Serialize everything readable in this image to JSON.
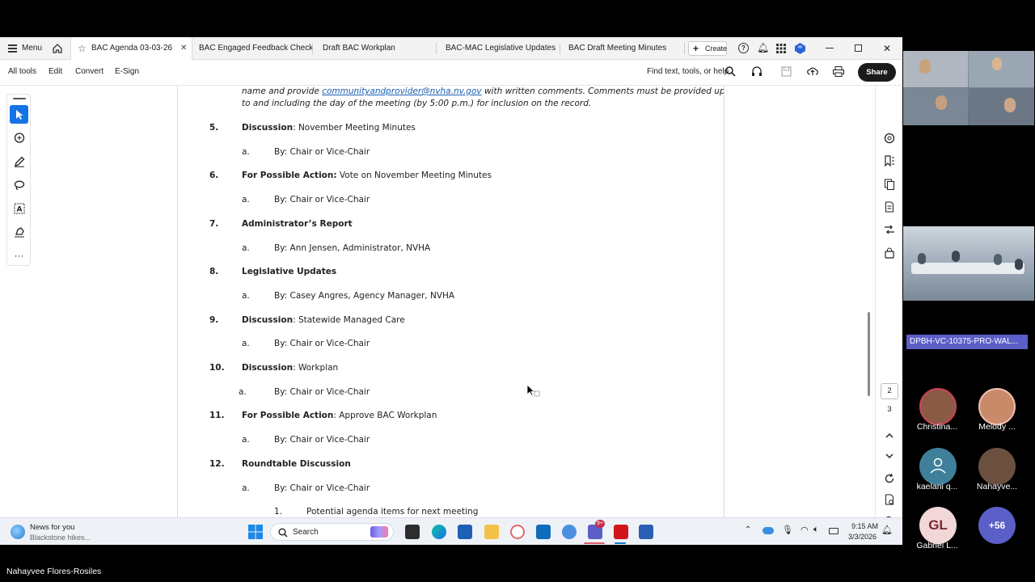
{
  "tabs": {
    "menu_label": "Menu",
    "items": [
      {
        "label": "BAC Agenda 03-03-26"
      },
      {
        "label": "BAC Engaged Feedback Checklis.."
      },
      {
        "label": "Draft BAC Workplan"
      },
      {
        "label": "BAC-MAC Legislative Updates"
      },
      {
        "label": "BAC Draft Meeting Minutes"
      }
    ],
    "create_label": "Create"
  },
  "toolbar": {
    "items": [
      "All tools",
      "Edit",
      "Convert",
      "E-Sign"
    ],
    "find_label": "Find text, tools, or help",
    "share_label": "Share"
  },
  "document": {
    "intro_line1_pre": "name and provide ",
    "intro_link": "communityandprovider@nvha.nv.gov",
    "intro_line1_post": " with written comments. Comments must be provided up",
    "intro_line2": "to and including the day of the meeting (by 5:00 p.m.) for inclusion on the record.",
    "items": [
      {
        "num": "5.",
        "bold": "Discussion",
        "rest": ": November Meeting Minutes",
        "sub_letter": "a.",
        "sub": "By: Chair or Vice-Chair"
      },
      {
        "num": "6.",
        "bold": "For Possible Action:",
        "rest": " Vote on November Meeting Minutes",
        "sub_letter": "a.",
        "sub": "By: Chair or Vice-Chair"
      },
      {
        "num": "7.",
        "bold": "Administrator’s Report",
        "rest": "",
        "sub_letter": "a.",
        "sub": "By: Ann Jensen, Administrator, NVHA"
      },
      {
        "num": "8.",
        "bold": "Legislative Updates",
        "rest": "",
        "sub_letter": "a.",
        "sub": "By: Casey Angres, Agency Manager, NVHA"
      },
      {
        "num": "9.",
        "bold": "Discussion",
        "rest": ": Statewide Managed Care",
        "sub_letter": "a.",
        "sub": "By: Chair or Vice-Chair"
      },
      {
        "num": "10.",
        "bold": "Discussion",
        "rest": ": Workplan",
        "sub_letter": "a.",
        "sub": "By: Chair or Vice-Chair"
      },
      {
        "num": "11.",
        "bold": "For Possible Action",
        "rest": ": Approve BAC Workplan",
        "sub_letter": "a.",
        "sub": "By: Chair or Vice-Chair"
      },
      {
        "num": "12.",
        "bold": "Roundtable Discussion",
        "rest": "",
        "sub_letter": "a.",
        "sub": "By: Chair or Vice-Chair"
      }
    ],
    "subsub_num": "1.",
    "subsub_text": "Potential agenda items for next meeting"
  },
  "pages": {
    "current": "2",
    "next": "3"
  },
  "taskbar": {
    "news_title": "News for you",
    "news_sub": "Blackstone hikes...",
    "search_label": "Search",
    "time": "9:15 AM",
    "date": "3/3/2026",
    "badge": "9+"
  },
  "meeting": {
    "room_label": "DPBH-VC-10375-PRO-WAL...",
    "participants": [
      {
        "name": "Christina...",
        "color": "#8a5a44"
      },
      {
        "name": "Melody ...",
        "color": "#c98a6a"
      },
      {
        "name": "kaelani q...",
        "color": "#3f7f9a"
      },
      {
        "name": "Nahayve...",
        "color": "#6b5040"
      },
      {
        "name": "Gabriel L...",
        "initials": "GL",
        "color": "#f2d7d9"
      }
    ],
    "more_count": "+56",
    "presenter_name": "Nahayvee Flores-Rosiles"
  }
}
